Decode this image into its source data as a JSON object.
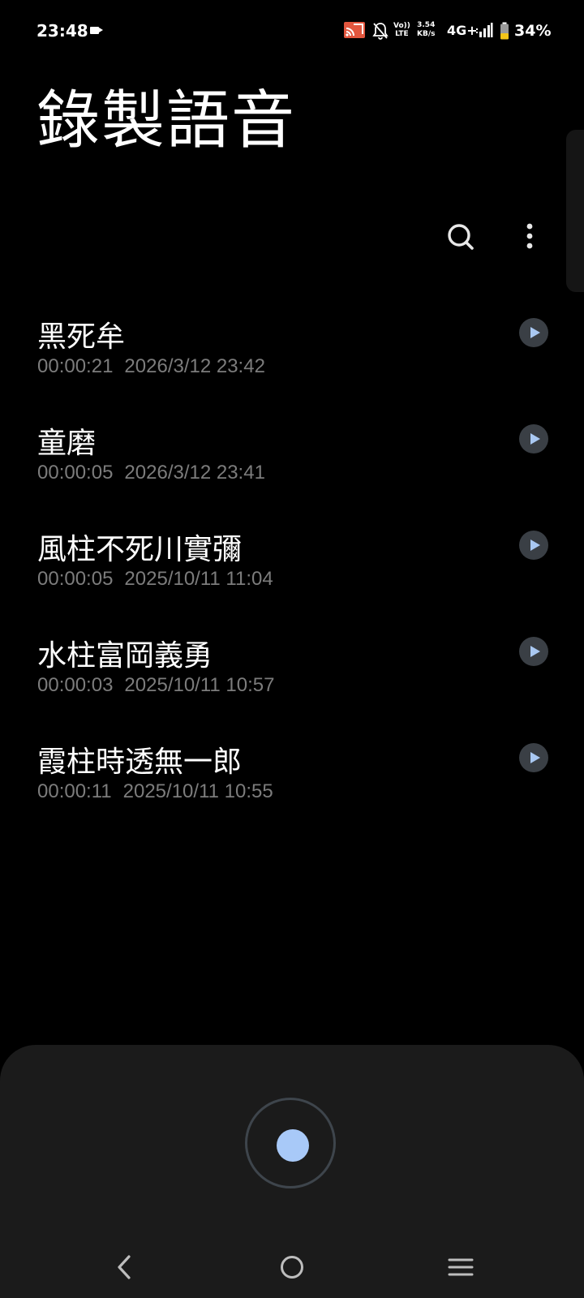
{
  "status_bar": {
    "time": "23:48",
    "volte_top": "Vo))",
    "volte_bottom": "LTE",
    "speed_value": "3.54",
    "speed_unit": "KB/s",
    "network": "4G+",
    "battery": "34%",
    "icons": [
      "video-record-icon",
      "cast-icon",
      "bell-off-icon",
      "signal-icon",
      "battery-icon"
    ]
  },
  "header": {
    "title": "錄製語音"
  },
  "toolbar": {
    "icons": [
      "search-icon",
      "more-vert-icon"
    ]
  },
  "recordings": [
    {
      "name": "黑死牟",
      "duration": "00:00:21",
      "date": "2026/3/12 23:42"
    },
    {
      "name": "童磨",
      "duration": "00:00:05",
      "date": "2026/3/12 23:41"
    },
    {
      "name": "風柱不死川實彌",
      "duration": "00:00:05",
      "date": "2025/10/11 11:04"
    },
    {
      "name": "水柱富岡義勇",
      "duration": "00:00:03",
      "date": "2025/10/11 10:57"
    },
    {
      "name": "霞柱時透無一郎",
      "duration": "00:00:11",
      "date": "2025/10/11 10:55"
    }
  ],
  "colors": {
    "background": "#000000",
    "panel": "#1b1b1b",
    "accent": "#a8c9f8",
    "meta_text": "#7c7c7c",
    "play_bg": "#3a3f45",
    "cast_icon": "#e2563e",
    "battery_fill": "#f5c518"
  },
  "nav": {
    "icons": [
      "back-icon",
      "home-icon",
      "recents-icon"
    ]
  }
}
